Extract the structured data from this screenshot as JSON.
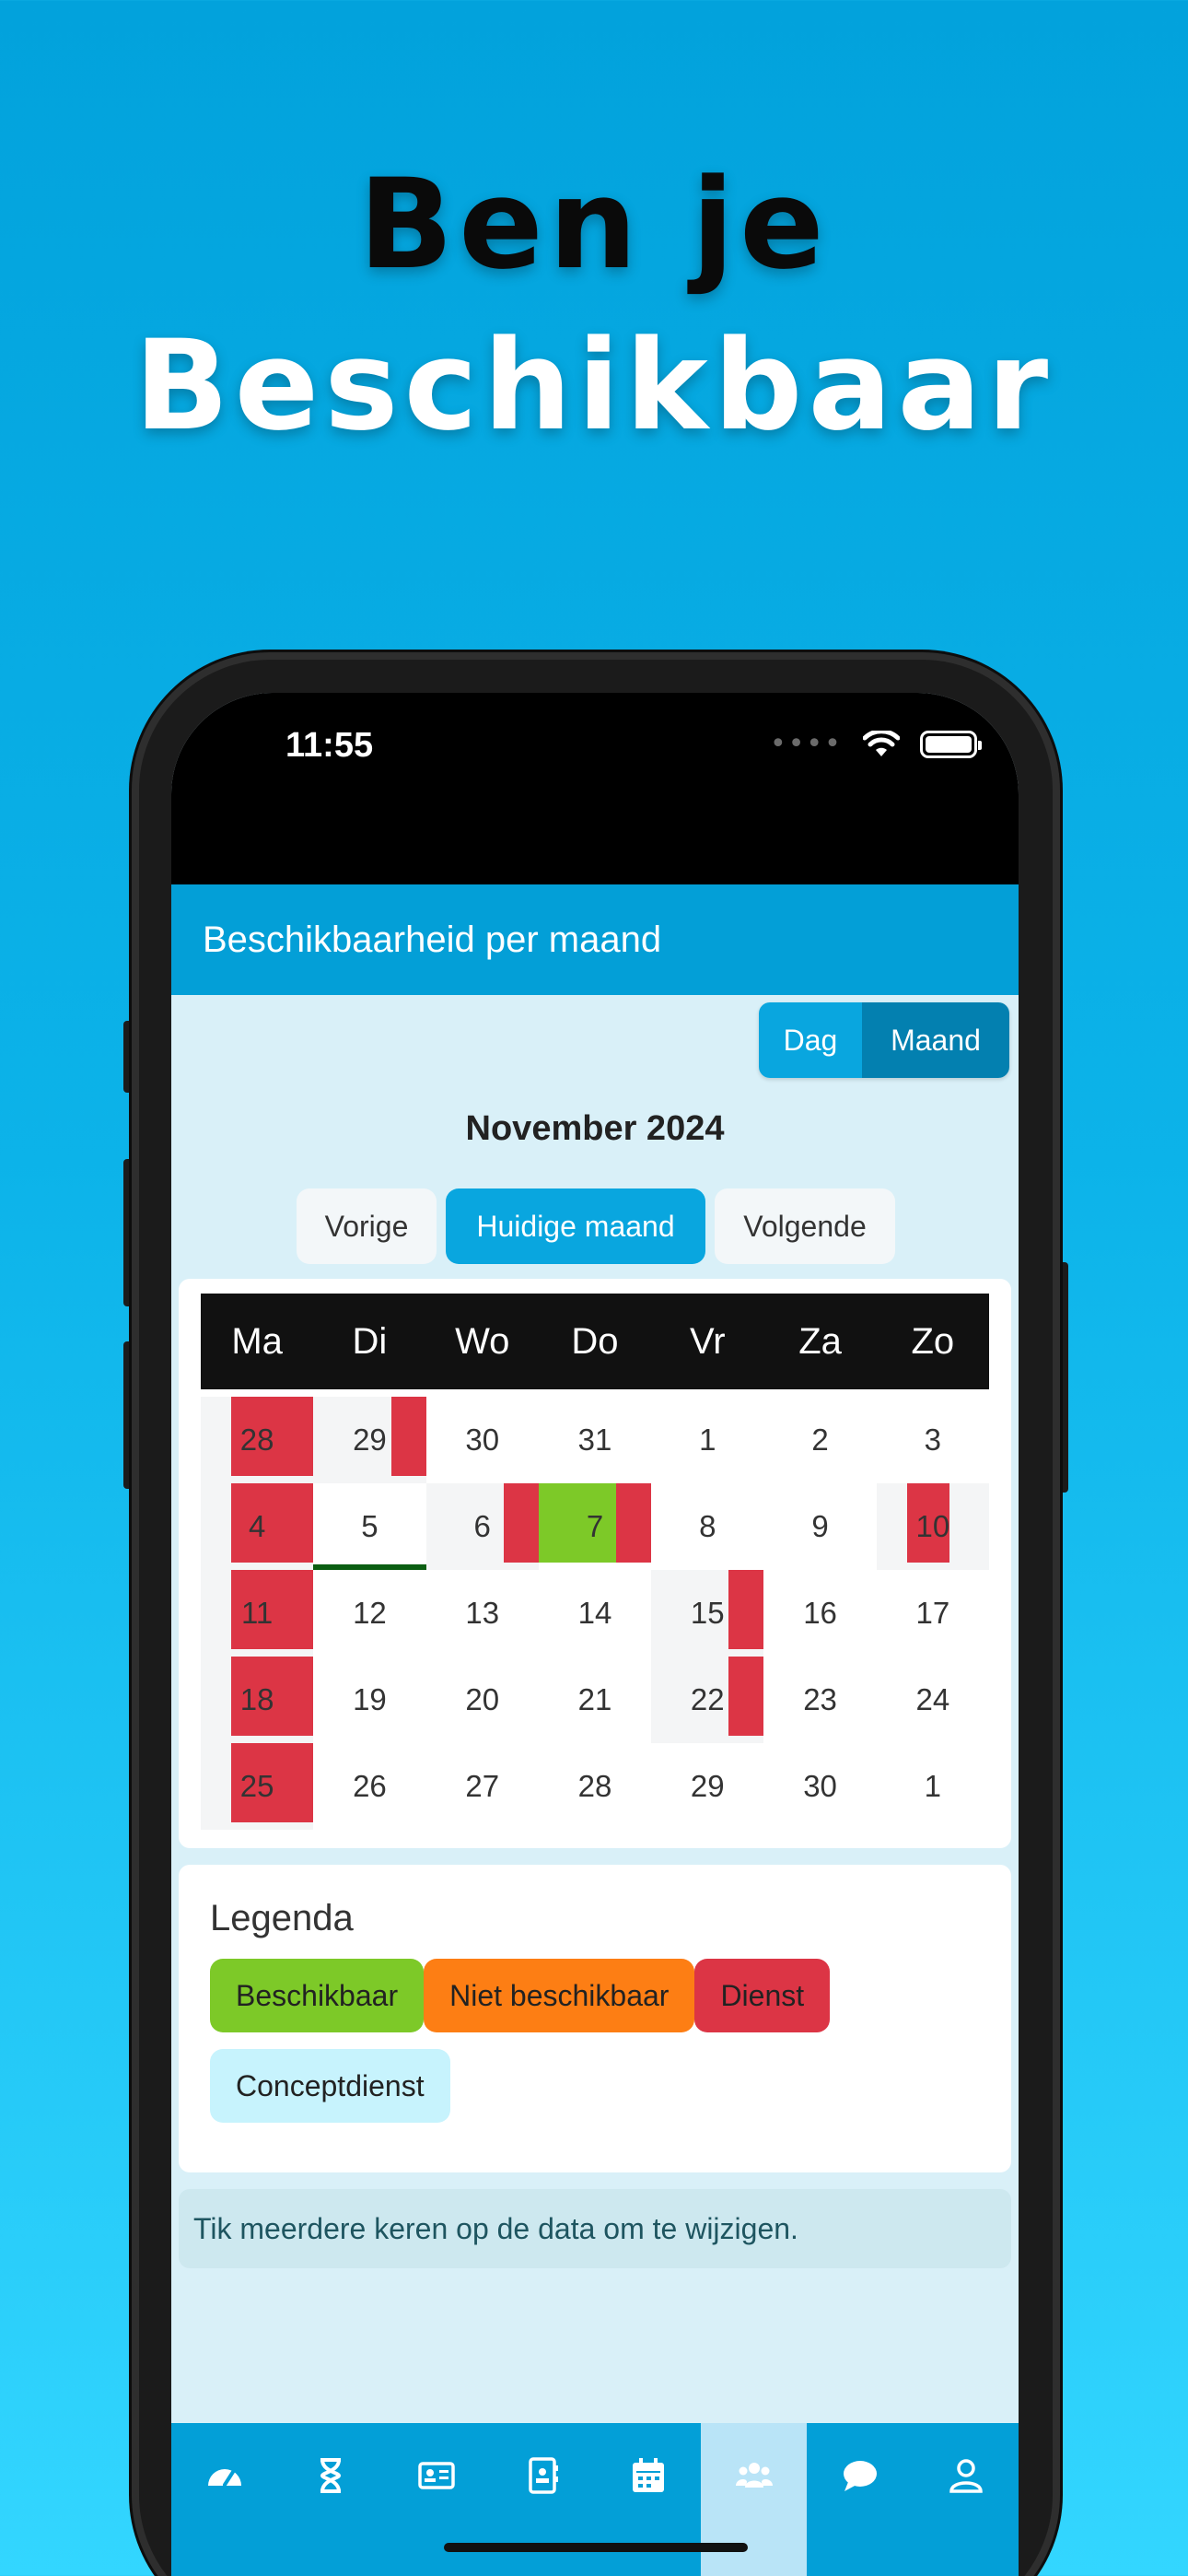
{
  "promo": {
    "line1": "Ben je",
    "line2": "Beschikbaar"
  },
  "status": {
    "time": "11:55",
    "dots": "••••"
  },
  "app": {
    "title": "Beschikbaarheid per maand"
  },
  "view_toggle": {
    "day": "Dag",
    "month": "Maand",
    "selected": "Maand"
  },
  "calendar": {
    "month_title": "November 2024",
    "prev": "Vorige",
    "current": "Huidige maand",
    "next": "Volgende",
    "weekdays": [
      "Ma",
      "Di",
      "Wo",
      "Do",
      "Vr",
      "Za",
      "Zo"
    ],
    "weeks": [
      [
        "28",
        "29",
        "30",
        "31",
        "1",
        "2",
        "3"
      ],
      [
        "4",
        "5",
        "6",
        "7",
        "8",
        "9",
        "10"
      ],
      [
        "11",
        "12",
        "13",
        "14",
        "15",
        "16",
        "17"
      ],
      [
        "18",
        "19",
        "20",
        "21",
        "22",
        "23",
        "24"
      ],
      [
        "25",
        "26",
        "27",
        "28",
        "29",
        "30",
        "1"
      ]
    ]
  },
  "legend": {
    "title": "Legenda",
    "items": [
      "Beschikbaar",
      "Niet beschikbaar",
      "Dienst",
      "Conceptdienst"
    ],
    "colors": {
      "available": "#7dc928",
      "unavailable": "#fd7e14",
      "shift": "#dc3545",
      "concept": "#c7f3fd"
    }
  },
  "info": "Tik meerdere keren op de data om te wijzigen.",
  "tabbar": {
    "icons": [
      "dashboard-icon",
      "hourglass-icon",
      "id-card-icon",
      "contacts-icon",
      "calendar-icon",
      "users-icon",
      "chat-icon",
      "user-icon"
    ],
    "active": "users-icon"
  },
  "theme": {
    "primary": "#039fd7",
    "dark_primary": "#0380b0",
    "background": "#d9f0f8"
  }
}
